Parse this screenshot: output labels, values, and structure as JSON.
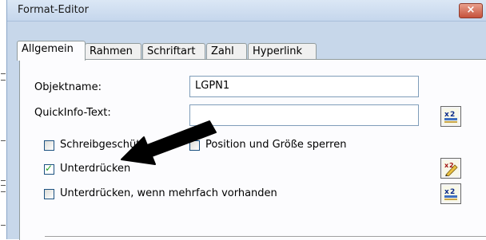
{
  "window": {
    "title": "Format-Editor",
    "close_label": "×"
  },
  "tabs": [
    {
      "label": "Allgemein",
      "active": true
    },
    {
      "label": "Rahmen",
      "active": false
    },
    {
      "label": "Schriftart",
      "active": false
    },
    {
      "label": "Zahl",
      "active": false
    },
    {
      "label": "Hyperlink",
      "active": false
    }
  ],
  "form": {
    "objektname_label": "Objektname:",
    "objektname_value": "LGPN1",
    "quickinfo_label": "QuickInfo-Text:",
    "quickinfo_value": ""
  },
  "checkboxes": {
    "schreibgeschuetzt": {
      "label": "Schreibgeschütz",
      "checked": false
    },
    "position": {
      "label": "Position und Größe sperren",
      "checked": false
    },
    "unterdruecken": {
      "label": "Unterdrücken",
      "checked": true
    },
    "unterdruecken_mehrfach": {
      "label": "Unterdrücken, wenn mehrfach vorhanden",
      "checked": false
    }
  },
  "icons": [
    "formula-x2-icon",
    "formula-edit-pencil-icon",
    "formula-x2-icon"
  ],
  "colors": {
    "titlebar": "#c5d6ec",
    "panel": "#fcfcfe",
    "close": "#c5523b",
    "check": "#21a121"
  }
}
